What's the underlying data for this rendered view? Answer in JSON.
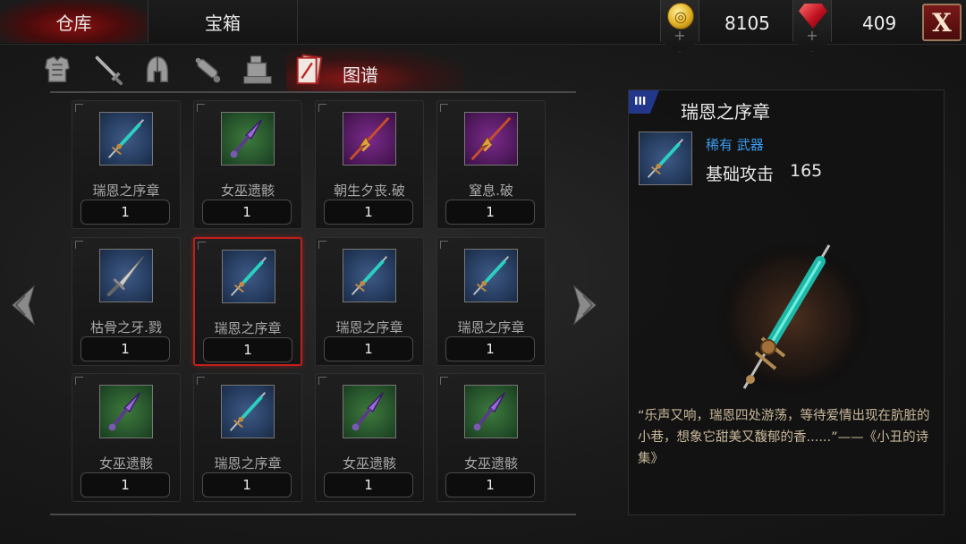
{
  "tabs": {
    "warehouse": "仓库",
    "chest": "宝箱"
  },
  "currency": {
    "gold": {
      "icon": "gold-coin-icon",
      "value": "8105"
    },
    "gems": {
      "icon": "red-gem-icon",
      "value": "409"
    },
    "plus": "+"
  },
  "close_label": "X",
  "categories": {
    "icons": [
      "armor-icon",
      "sword-icon",
      "helmet-icon",
      "potion-icon",
      "materials-icon",
      "codex-icon"
    ],
    "active_label": "图谱"
  },
  "items": [
    {
      "name": "瑞恩之序章",
      "qty": "1",
      "rarity": "blue",
      "icon": "spear-icon"
    },
    {
      "name": "女巫遗骸",
      "qty": "1",
      "rarity": "green",
      "icon": "dagger-icon"
    },
    {
      "name": "朝生夕丧.破",
      "qty": "1",
      "rarity": "purple",
      "icon": "halberd-icon"
    },
    {
      "name": "窒息.破",
      "qty": "1",
      "rarity": "purple",
      "icon": "halberd-icon"
    },
    {
      "name": "枯骨之牙.戮",
      "qty": "1",
      "rarity": "blue",
      "icon": "sword-icon"
    },
    {
      "name": "瑞恩之序章",
      "qty": "1",
      "rarity": "blue",
      "icon": "spear-icon",
      "selected": true
    },
    {
      "name": "瑞恩之序章",
      "qty": "1",
      "rarity": "blue",
      "icon": "spear-icon"
    },
    {
      "name": "瑞恩之序章",
      "qty": "1",
      "rarity": "blue",
      "icon": "spear-icon"
    },
    {
      "name": "女巫遗骸",
      "qty": "1",
      "rarity": "green",
      "icon": "dagger-icon"
    },
    {
      "name": "瑞恩之序章",
      "qty": "1",
      "rarity": "blue",
      "icon": "spear-icon"
    },
    {
      "name": "女巫遗骸",
      "qty": "1",
      "rarity": "green",
      "icon": "dagger-icon"
    },
    {
      "name": "女巫遗骸",
      "qty": "1",
      "rarity": "green",
      "icon": "dagger-icon"
    }
  ],
  "detail": {
    "tier": "III",
    "title": "瑞恩之序章",
    "rarity_type": "稀有 武器",
    "stat_label": "基础攻击",
    "stat_value": "165",
    "description": "“乐声又响，瑞恩四处游荡，等待爱情出现在肮脏的小巷，想象它甜美又馥郁的香......”——《小丑的诗集》"
  },
  "colors": {
    "accent_red": "#c0201c",
    "rarity_blue": "#2c4670",
    "rarity_green": "#2e5e2e",
    "rarity_purple": "#5e1e6c",
    "rarity_text_blue": "#3a9cf0",
    "description_text": "#c9b89a"
  }
}
